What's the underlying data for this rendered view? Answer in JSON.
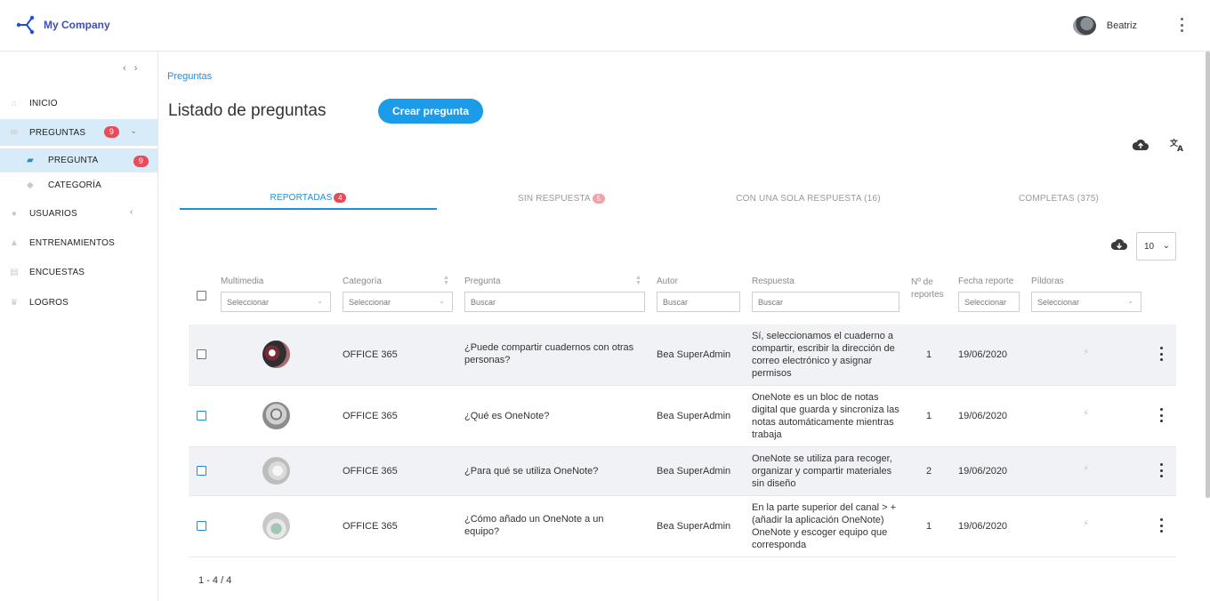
{
  "app": {
    "brand": "My Company",
    "user": "Beatriz"
  },
  "sidebar": {
    "items": [
      {
        "label": "INICIO",
        "icon": "home-icon"
      },
      {
        "label": "PREGUNTAS",
        "icon": "chat-icon",
        "badge": "9"
      },
      {
        "label": "PREGUNTA",
        "icon": "book-icon",
        "badge": "9"
      },
      {
        "label": "CATEGORÍA",
        "icon": "tag-icon"
      },
      {
        "label": "USUARIOS",
        "icon": "user-icon"
      },
      {
        "label": "ENTRENAMIENTOS",
        "icon": "graduation-icon"
      },
      {
        "label": "ENCUESTAS",
        "icon": "survey-icon"
      },
      {
        "label": "LOGROS",
        "icon": "trophy-icon"
      }
    ]
  },
  "breadcrumb": "Preguntas",
  "page": {
    "title": "Listado de preguntas",
    "create_label": "Crear pregunta"
  },
  "tabs": [
    {
      "label": "REPORTADAS",
      "badge": "4"
    },
    {
      "label": "SIN RESPUESTA",
      "badge": "5"
    },
    {
      "label": "CON UNA SOLA RESPUESTA (16)"
    },
    {
      "label": "COMPLETAS (375)"
    }
  ],
  "page_size": "10",
  "columns": {
    "multimedia": "Multimedia",
    "categoria": "Categoría",
    "pregunta": "Pregunta",
    "autor": "Autor",
    "respuesta": "Respuesta",
    "reportes": "Nº de reportes",
    "fecha": "Fecha reporte",
    "pildoras": "Píldoras"
  },
  "filters": {
    "select_placeholder": "Seleccionar",
    "search_placeholder": "Buscar"
  },
  "rows": [
    {
      "categoria": "OFFICE 365",
      "pregunta": "¿Puede compartir cuadernos con otras personas?",
      "autor": "Bea SuperAdmin",
      "respuesta": "Sí, seleccionamos el cuaderno a compartir, escribir la dirección de correo electrónico y asignar permisos",
      "reportes": "1",
      "fecha": "19/06/2020"
    },
    {
      "categoria": "OFFICE 365",
      "pregunta": "¿Qué es OneNote?",
      "autor": "Bea SuperAdmin",
      "respuesta": "OneNote es un bloc de notas digital que guarda y sincroniza las notas automáticamente mientras trabaja",
      "reportes": "1",
      "fecha": "19/06/2020"
    },
    {
      "categoria": "OFFICE 365",
      "pregunta": "¿Para qué se utiliza OneNote?",
      "autor": "Bea SuperAdmin",
      "respuesta": "OneNote se utiliza para recoger, organizar y compartir materiales sin diseño",
      "reportes": "2",
      "fecha": "19/06/2020"
    },
    {
      "categoria": "OFFICE 365",
      "pregunta": "¿Cómo añado un OneNote a un equipo?",
      "autor": "Bea SuperAdmin",
      "respuesta": "En la parte superior del canal > + (añadir la aplicación OneNote) OneNote y escoger equipo que corresponda",
      "reportes": "1",
      "fecha": "19/06/2020"
    }
  ],
  "pagination": "1 - 4 / 4",
  "colors": {
    "accent": "#1c9be9",
    "badge": "#e94b59",
    "active_nav": "#d7ebf9"
  }
}
